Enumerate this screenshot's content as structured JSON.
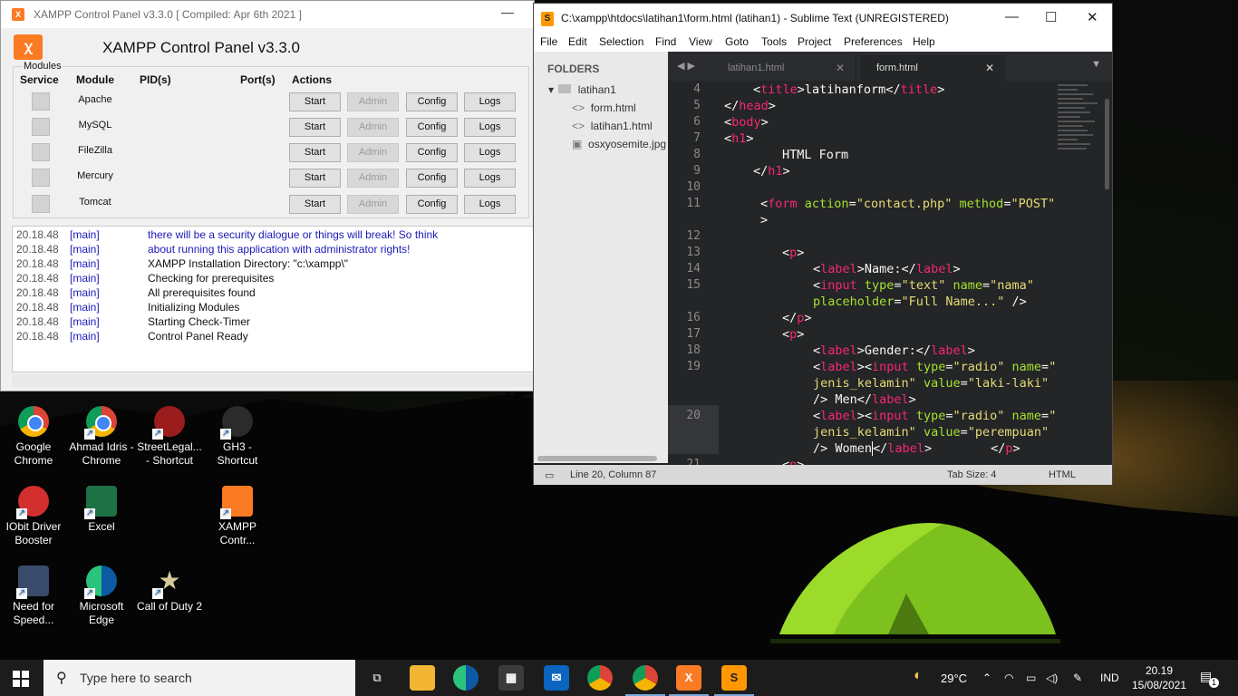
{
  "xampp": {
    "window_title": "XAMPP Control Panel v3.3.0   [ Compiled: Apr 6th 2021 ]",
    "logo_text": "ꭓ",
    "main_title": "XAMPP Control Panel v3.3.0",
    "modules_caption": "Modules",
    "columns": [
      "Service",
      "Module",
      "PID(s)",
      "Port(s)",
      "Actions"
    ],
    "modules": [
      {
        "name": "Apache"
      },
      {
        "name": "MySQL"
      },
      {
        "name": "FileZilla"
      },
      {
        "name": "Mercury"
      },
      {
        "name": "Tomcat"
      }
    ],
    "buttons": {
      "start": "Start",
      "admin": "Admin",
      "config": "Config",
      "logs": "Logs"
    },
    "log": [
      {
        "time": "20.18.48",
        "module": "[main]",
        "text": "there will be a security dialogue or things will break! So think",
        "blue": true
      },
      {
        "time": "20.18.48",
        "module": "[main]",
        "text": "about running this application with administrator rights!",
        "blue": true
      },
      {
        "time": "20.18.48",
        "module": "[main]",
        "text": "XAMPP Installation Directory: \"c:\\xampp\\\"",
        "blue": false
      },
      {
        "time": "20.18.48",
        "module": "[main]",
        "text": "Checking for prerequisites",
        "blue": false
      },
      {
        "time": "20.18.48",
        "module": "[main]",
        "text": "All prerequisites found",
        "blue": false
      },
      {
        "time": "20.18.48",
        "module": "[main]",
        "text": "Initializing Modules",
        "blue": false
      },
      {
        "time": "20.18.48",
        "module": "[main]",
        "text": "Starting Check-Timer",
        "blue": false
      },
      {
        "time": "20.18.48",
        "module": "[main]",
        "text": "Control Panel Ready",
        "blue": false
      }
    ]
  },
  "sublime": {
    "window_title": "C:\\xampp\\htdocs\\latihan1\\form.html (latihan1) - Sublime Text (UNREGISTERED)",
    "menu": [
      "File",
      "Edit",
      "Selection",
      "Find",
      "View",
      "Goto",
      "Tools",
      "Project",
      "Preferences",
      "Help"
    ],
    "sidebar": {
      "heading": "FOLDERS",
      "folder": "latihan1",
      "files": [
        "form.html",
        "latihan1.html",
        "osxyosemite.jpg"
      ]
    },
    "tabs": [
      {
        "label": "latihan1.html",
        "active": false
      },
      {
        "label": "form.html",
        "active": true
      }
    ],
    "line_numbers": [
      "4",
      "5",
      "6",
      "7",
      "8",
      "9",
      "10",
      "11",
      "",
      "12",
      "13",
      "14",
      "15",
      "",
      "16",
      "17",
      "18",
      "19",
      "",
      "",
      "20",
      "",
      "",
      "21"
    ],
    "status": {
      "position": "Line 20, Column 87",
      "tab_size": "Tab Size: 4",
      "syntax": "HTML"
    }
  },
  "desktop_icons": [
    {
      "label": "Google Chrome",
      "icon": "chrome-icon"
    },
    {
      "label": "Ahmad Idris - Chrome",
      "icon": "chrome-profile-icon"
    },
    {
      "label": "StreetLegal... - Shortcut",
      "icon": "streetlegal-icon"
    },
    {
      "label": "GH3 - Shortcut",
      "icon": "gh3-icon"
    },
    {
      "label": "IObit Driver Booster",
      "icon": "driver-booster-icon"
    },
    {
      "label": "Excel",
      "icon": "excel-icon"
    },
    {
      "label": "XAMPP Contr...",
      "icon": "xampp-icon"
    },
    {
      "label": "Need for Speed...",
      "icon": "nfs-icon"
    },
    {
      "label": "Microsoft Edge",
      "icon": "edge-icon"
    },
    {
      "label": "Call of Duty 2",
      "icon": "cod2-icon"
    }
  ],
  "taskbar": {
    "search_placeholder": "Type here to search",
    "weather": "29°C",
    "language": "IND",
    "time": "20.19",
    "date": "15/08/2021",
    "notifications": "1"
  }
}
